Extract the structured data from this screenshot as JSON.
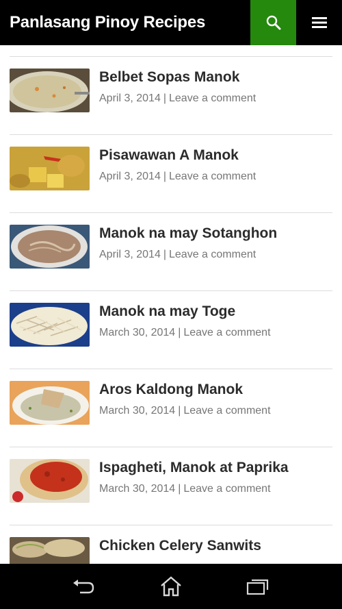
{
  "header": {
    "site_title": "Panlasang Pinoy Recipes",
    "search_icon": "search-icon",
    "menu_icon": "hamburger-menu-icon",
    "accent_color": "#24890d"
  },
  "posts": [
    {
      "title": "Belbet Sopas Manok",
      "date": "April 3, 2014",
      "comment_link": "Leave a comment"
    },
    {
      "title": "Pisawawan A Manok",
      "date": "April 3, 2014",
      "comment_link": "Leave a comment"
    },
    {
      "title": "Manok na may Sotanghon",
      "date": "April 3, 2014",
      "comment_link": "Leave a comment"
    },
    {
      "title": "Manok na may Toge",
      "date": "March 30, 2014",
      "comment_link": "Leave a comment"
    },
    {
      "title": "Aros Kaldong Manok",
      "date": "March 30, 2014",
      "comment_link": "Leave a comment"
    },
    {
      "title": "Ispagheti, Manok at Paprika",
      "date": "March 30, 2014",
      "comment_link": "Leave a comment"
    },
    {
      "title": "Chicken Celery Sanwits",
      "date": "",
      "comment_link": ""
    }
  ],
  "meta_separator": "|",
  "system_nav": {
    "back_icon": "back-icon",
    "home_icon": "home-icon",
    "recents_icon": "recent-apps-icon"
  }
}
